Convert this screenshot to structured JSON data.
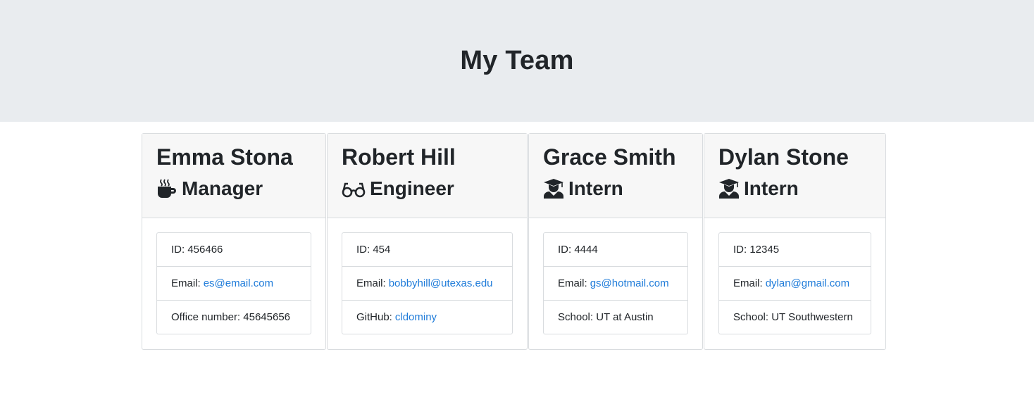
{
  "header": {
    "title": "My Team"
  },
  "team": [
    {
      "name": "Emma Stona",
      "role": "Manager",
      "icon": "coffee-mug-icon",
      "id_label": "ID: 456466",
      "email_prefix": "Email:",
      "email": "es@email.com",
      "extra_prefix": "Office number: 45645656",
      "extra_link": ""
    },
    {
      "name": "Robert Hill",
      "role": "Engineer",
      "icon": "glasses-icon",
      "id_label": "ID: 454",
      "email_prefix": "Email:",
      "email": "bobbyhill@utexas.edu",
      "extra_prefix": "GitHub:",
      "extra_link": "cldominy"
    },
    {
      "name": "Grace Smith",
      "role": "Intern",
      "icon": "graduate-icon",
      "id_label": "ID: 4444",
      "email_prefix": "Email:",
      "email": "gs@hotmail.com",
      "extra_prefix": "School: UT at Austin",
      "extra_link": ""
    },
    {
      "name": "Dylan Stone",
      "role": "Intern",
      "icon": "graduate-icon",
      "id_label": "ID: 12345",
      "email_prefix": "Email:",
      "email": "dylan@gmail.com",
      "extra_prefix": "School: UT Southwestern",
      "extra_link": ""
    }
  ],
  "colors": {
    "jumbotron": "#e9ecef",
    "link": "#1e7bd9",
    "card_header": "#f7f7f7",
    "text": "#212529"
  }
}
